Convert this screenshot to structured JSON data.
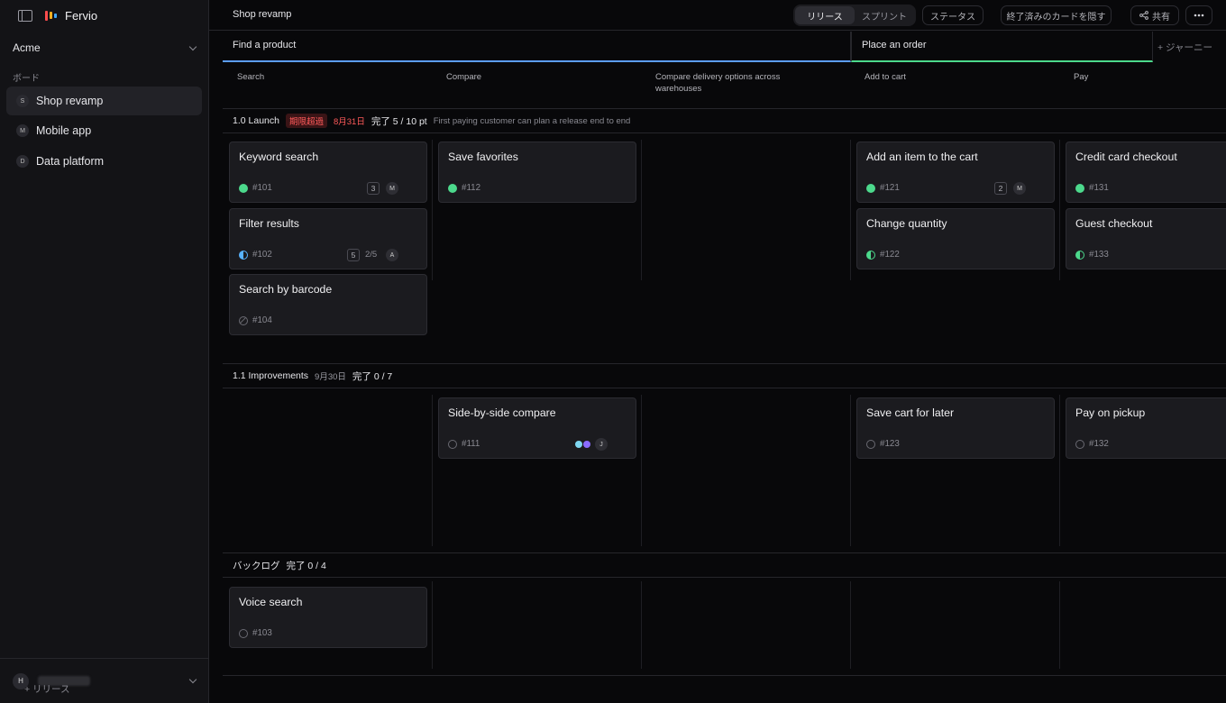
{
  "app": {
    "name": "Fervio",
    "logo_colors": [
      "#ff4d4d",
      "#ffb020",
      "#3ea8ff"
    ]
  },
  "sidebar": {
    "workspace": "Acme",
    "section_label": "ボード",
    "boards": [
      {
        "letter": "S",
        "name": "Shop revamp"
      },
      {
        "letter": "M",
        "name": "Mobile app"
      },
      {
        "letter": "D",
        "name": "Data platform"
      }
    ],
    "user": {
      "initial": "H"
    }
  },
  "topbar": {
    "title": "Shop revamp",
    "view_release": "リリース",
    "view_sprint": "スプリント",
    "status_btn": "ステータス",
    "hide_done_btn": "終了済みのカードを隠す",
    "share_btn": "共有"
  },
  "journeys": [
    {
      "name": "Find a product",
      "accent": "#5b9dff"
    },
    {
      "name": "Place an order",
      "accent": "#4cd98c"
    }
  ],
  "add_journey": "+ ジャーニー",
  "steps": [
    "Search",
    "Compare",
    "Compare delivery options across warehouses",
    "Add to cart",
    "Pay"
  ],
  "releases": {
    "r1": {
      "name": "1.0 Launch",
      "overdue": "期限超過",
      "due": "8月31日",
      "done": "完了 5 / 10 pt",
      "desc": "First paying customer can plan a release end to end"
    },
    "r2": {
      "name": "1.1 Improvements",
      "due": "9月30日",
      "done": "完了 0 / 7"
    },
    "backlog": {
      "name": "バックログ",
      "done": "完了 0 / 4"
    }
  },
  "cards": {
    "c101": {
      "title": "Keyword search",
      "num": "#101",
      "status": "done",
      "estimate": "3",
      "assignee": "M"
    },
    "c102": {
      "title": "Filter results",
      "num": "#102",
      "status": "in-progress",
      "estimate": "5",
      "progress": "2/5",
      "assignee": "A"
    },
    "c104": {
      "title": "Search by barcode",
      "num": "#104",
      "status": "canceled"
    },
    "c112": {
      "title": "Save favorites",
      "num": "#112",
      "status": "done"
    },
    "c121": {
      "title": "Add an item to the cart",
      "num": "#121",
      "status": "done",
      "estimate": "2",
      "assignee": "M"
    },
    "c122": {
      "title": "Change quantity",
      "num": "#122",
      "status": "in-review"
    },
    "c131": {
      "title": "Credit card checkout",
      "num": "#131",
      "status": "done"
    },
    "c133": {
      "title": "Guest checkout",
      "num": "#133",
      "status": "in-review"
    },
    "c111": {
      "title": "Side-by-side compare",
      "num": "#111",
      "status": "todo",
      "assignee": "J",
      "tag_colors": [
        "#7ed6f0",
        "#8a6cff"
      ]
    },
    "c123": {
      "title": "Save cart for later",
      "num": "#123",
      "status": "todo"
    },
    "c132": {
      "title": "Pay on pickup",
      "num": "#132",
      "status": "todo"
    },
    "c103": {
      "title": "Voice search",
      "num": "#103",
      "status": "todo"
    }
  },
  "add_release": "+ リリース"
}
